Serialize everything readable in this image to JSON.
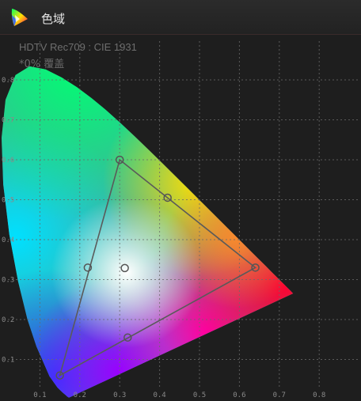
{
  "header": {
    "title": "色域",
    "icon": "color-gamut-icon"
  },
  "info": {
    "standard": "HDTV Rec709 : CIE 1931",
    "coverage": "*0% 覆盖"
  },
  "colors": {
    "background": "#1e1e1e",
    "grid": "#5a5a5a",
    "triangle": "#5c5c5c",
    "text_muted": "#6e6e6e"
  },
  "chart_data": {
    "type": "scatter",
    "xlim": [
      0.0,
      0.85
    ],
    "ylim": [
      0.0,
      0.9
    ],
    "x_ticks": [
      "0.1",
      "0.2",
      "0.3",
      "0.4",
      "0.5",
      "0.6",
      "0.7",
      "0.8"
    ],
    "y_ticks": [
      "0.1",
      "0.2",
      "0.3",
      "0.4",
      "0.5",
      "0.6",
      "0.7",
      "0.8"
    ],
    "x_tick_values": [
      0.1,
      0.2,
      0.3,
      0.4,
      0.5,
      0.6,
      0.7,
      0.8
    ],
    "y_tick_values": [
      0.1,
      0.2,
      0.3,
      0.4,
      0.5,
      0.6,
      0.7,
      0.8
    ],
    "grid": true,
    "triangle_vertices": [
      {
        "x": 0.64,
        "y": 0.33
      },
      {
        "x": 0.3,
        "y": 0.6
      },
      {
        "x": 0.15,
        "y": 0.06
      }
    ],
    "edge_midpoints": [
      {
        "x": 0.42,
        "y": 0.505
      },
      {
        "x": 0.22,
        "y": 0.33
      },
      {
        "x": 0.32,
        "y": 0.155
      }
    ],
    "white_point": {
      "x": 0.3127,
      "y": 0.329
    },
    "spectral_locus": [
      [
        0.1741,
        0.005
      ],
      [
        0.1738,
        0.0049
      ],
      [
        0.1736,
        0.0049
      ],
      [
        0.1733,
        0.0048
      ],
      [
        0.1726,
        0.0048
      ],
      [
        0.1714,
        0.0051
      ],
      [
        0.1689,
        0.0069
      ],
      [
        0.1644,
        0.0109
      ],
      [
        0.1566,
        0.0177
      ],
      [
        0.144,
        0.0297
      ],
      [
        0.1241,
        0.0578
      ],
      [
        0.0913,
        0.1327
      ],
      [
        0.0687,
        0.2007
      ],
      [
        0.0454,
        0.295
      ],
      [
        0.0235,
        0.4127
      ],
      [
        0.0082,
        0.5384
      ],
      [
        0.0039,
        0.6548
      ],
      [
        0.0139,
        0.7502
      ],
      [
        0.0389,
        0.812
      ],
      [
        0.0743,
        0.8338
      ],
      [
        0.1142,
        0.8262
      ],
      [
        0.1547,
        0.8059
      ],
      [
        0.1929,
        0.7816
      ],
      [
        0.2296,
        0.7543
      ],
      [
        0.2658,
        0.7243
      ],
      [
        0.3016,
        0.6923
      ],
      [
        0.3373,
        0.6589
      ],
      [
        0.3731,
        0.6245
      ],
      [
        0.4087,
        0.5896
      ],
      [
        0.4441,
        0.5547
      ],
      [
        0.4788,
        0.5202
      ],
      [
        0.5125,
        0.4866
      ],
      [
        0.5448,
        0.4544
      ],
      [
        0.5752,
        0.4242
      ],
      [
        0.6029,
        0.3965
      ],
      [
        0.627,
        0.3725
      ],
      [
        0.6482,
        0.3514
      ],
      [
        0.6658,
        0.334
      ],
      [
        0.6801,
        0.3197
      ],
      [
        0.6915,
        0.3083
      ],
      [
        0.7006,
        0.2993
      ],
      [
        0.7079,
        0.292
      ],
      [
        0.714,
        0.2859
      ],
      [
        0.719,
        0.2809
      ],
      [
        0.723,
        0.277
      ],
      [
        0.726,
        0.274
      ],
      [
        0.7283,
        0.2717
      ],
      [
        0.73,
        0.27
      ],
      [
        0.7311,
        0.2689
      ],
      [
        0.732,
        0.268
      ],
      [
        0.7327,
        0.2673
      ],
      [
        0.7334,
        0.2666
      ],
      [
        0.734,
        0.266
      ],
      [
        0.7344,
        0.2656
      ],
      [
        0.7347,
        0.2653
      ]
    ]
  }
}
